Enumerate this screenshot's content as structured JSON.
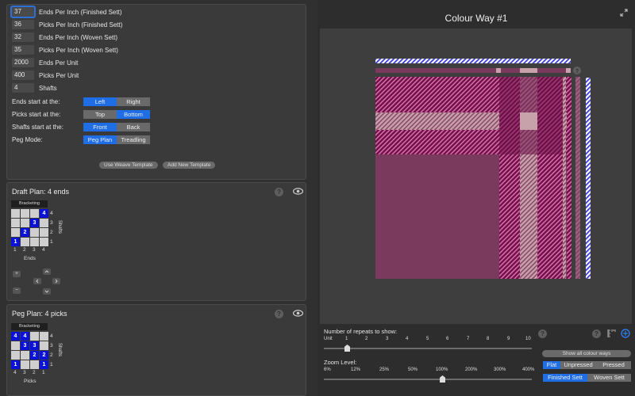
{
  "fields": [
    {
      "value": "37",
      "label": "Ends Per Inch (Finished Sett)"
    },
    {
      "value": "36",
      "label": "Picks Per Inch (Finished Sett)"
    },
    {
      "value": "32",
      "label": "Ends Per Inch (Woven Sett)"
    },
    {
      "value": "35",
      "label": "Picks Per Inch (Woven Sett)"
    },
    {
      "value": "2000",
      "label": "Ends Per Unit"
    },
    {
      "value": "400",
      "label": "Picks Per Unit"
    },
    {
      "value": "4",
      "label": "Shafts"
    }
  ],
  "options": [
    {
      "label": "Ends start at the:",
      "a": "Left",
      "b": "Right",
      "selected": "a"
    },
    {
      "label": "Picks start at the:",
      "a": "Top",
      "b": "Bottom",
      "selected": "b"
    },
    {
      "label": "Shafts start at the:",
      "a": "Front",
      "b": "Back",
      "selected": "a"
    },
    {
      "label": "Peg Mode:",
      "a": "Peg Plan",
      "b": "Treadling",
      "selected": "a"
    }
  ],
  "buttons": {
    "use_template": "Use Weave Template",
    "add_template": "Add New Template"
  },
  "draft": {
    "title": "Draft Plan:  4 ends",
    "caption": "Bracketing",
    "rows": [
      {
        "cells": [
          "",
          "",
          "",
          "4"
        ],
        "on": [
          false,
          false,
          false,
          true
        ],
        "shaft": "4"
      },
      {
        "cells": [
          "",
          "",
          "3",
          ""
        ],
        "on": [
          false,
          false,
          true,
          false
        ],
        "shaft": "3"
      },
      {
        "cells": [
          "",
          "2",
          "",
          ""
        ],
        "on": [
          false,
          true,
          false,
          false
        ],
        "shaft": "2"
      },
      {
        "cells": [
          "1",
          "",
          "",
          ""
        ],
        "on": [
          true,
          false,
          false,
          false
        ],
        "shaft": "1"
      }
    ],
    "cols": [
      "1",
      "2",
      "3",
      "4"
    ],
    "xlabel": "Ends",
    "ylabel": "Shafts",
    "plus": "+",
    "minus": "−"
  },
  "peg": {
    "title": "Peg Plan:  4 picks",
    "caption": "Bracketing",
    "rows": [
      {
        "cells": [
          "4",
          "4",
          "",
          ""
        ],
        "on": [
          true,
          true,
          false,
          false
        ],
        "shaft": "4"
      },
      {
        "cells": [
          "",
          "3",
          "3",
          ""
        ],
        "on": [
          false,
          true,
          true,
          false
        ],
        "shaft": "3"
      },
      {
        "cells": [
          "",
          "",
          "2",
          "2"
        ],
        "on": [
          false,
          false,
          true,
          true
        ],
        "shaft": "2"
      },
      {
        "cells": [
          "1",
          "",
          "",
          "1"
        ],
        "on": [
          true,
          false,
          false,
          true
        ],
        "shaft": "1"
      }
    ],
    "cols": [
      "4",
      "3",
      "2",
      "1"
    ],
    "xlabel": "Picks",
    "ylabel": "Shafts"
  },
  "right": {
    "title": "Colour Way #1",
    "repeats_label": "Number of repeats to show:",
    "repeat_ticks": [
      "Unit",
      "1",
      "2",
      "3",
      "4",
      "5",
      "6",
      "7",
      "8",
      "9",
      "10"
    ],
    "repeats_value": 1,
    "zoom_label": "Zoom Level:",
    "zoom_ticks": [
      "6%",
      "12%",
      "25%",
      "50%",
      "100%",
      "200%",
      "300%",
      "400%"
    ],
    "zoom_value": "100%",
    "show_all": "Show all colour ways",
    "finish": [
      "Flat",
      "Unpressed",
      "Pressed"
    ],
    "sett": [
      "Finished Sett",
      "Woven Sett"
    ],
    "help": "?"
  },
  "colors": {
    "accent": "#1f6ee6",
    "plum": "#6e1048",
    "rose": "#7a3a5e",
    "pink": "#c8a2aa",
    "blue": "#1c1cd8"
  }
}
